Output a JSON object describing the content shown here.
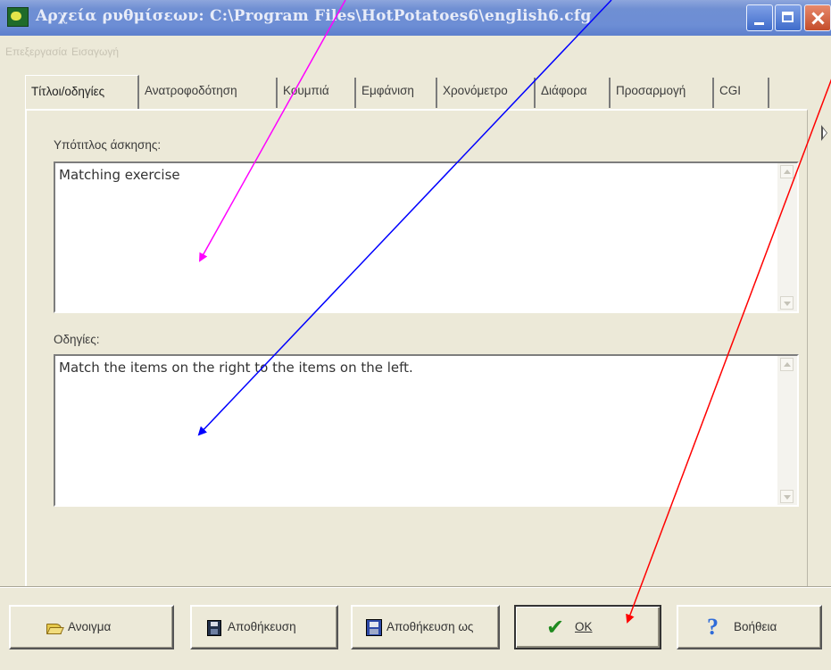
{
  "window": {
    "title": "Αρχεία ρυθμίσεων:  C:\\Program Files\\HotPotatoes6\\english6.cfg"
  },
  "menu": [
    "Επεξεργασία",
    "Εισαγωγή"
  ],
  "tabs": [
    {
      "label": "Τίτλοι/οδηγίες",
      "active": true
    },
    {
      "label": "Ανατροφοδότηση",
      "active": false
    },
    {
      "label": "Κουμπιά",
      "active": false
    },
    {
      "label": "Εμφάνιση",
      "active": false
    },
    {
      "label": "Χρονόμετρο",
      "active": false
    },
    {
      "label": "Διάφορα",
      "active": false
    },
    {
      "label": "Προσαρμογή",
      "active": false
    },
    {
      "label": "CGI",
      "active": false
    }
  ],
  "subtitle": {
    "label": "Υπότιτλος άσκησης:",
    "value": "Matching exercise"
  },
  "instructions": {
    "label": "Οδηγίες:",
    "value": "Match the items on the right to the items on the left."
  },
  "buttons": {
    "open": "Ανοιγμα",
    "save": "Αποθήκευση",
    "save_as": "Αποθήκευση ως",
    "ok": "OK",
    "help": "Βοήθεια"
  },
  "annotation_colors": [
    "#ff00ff",
    "#0000ff",
    "#ff0000"
  ]
}
